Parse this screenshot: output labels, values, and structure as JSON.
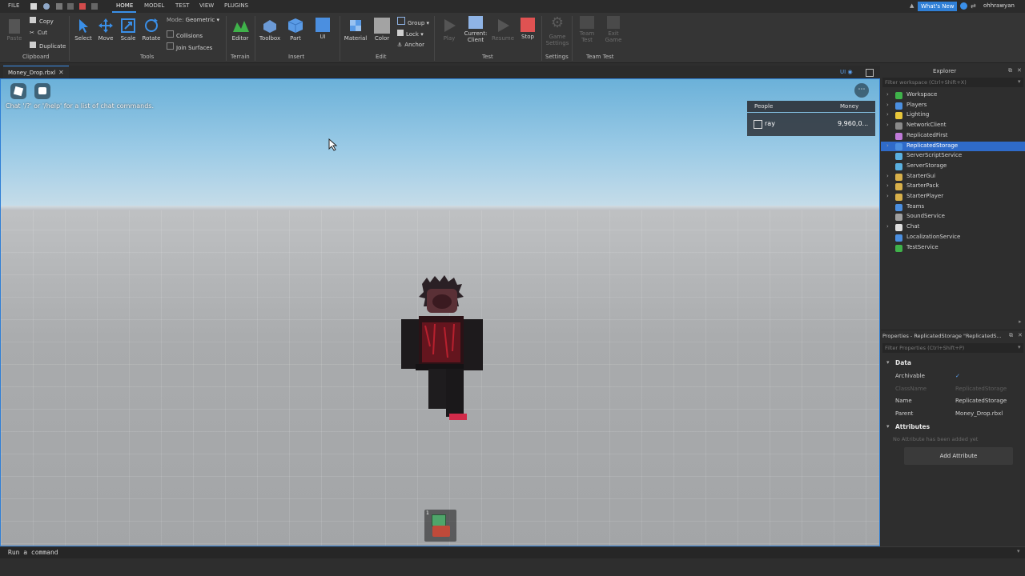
{
  "menubar": {
    "items": [
      "FILE",
      "HOME",
      "MODEL",
      "TEST",
      "VIEW",
      "PLUGINS"
    ],
    "whats_new": "What's New",
    "username": "ohhrawyan"
  },
  "ribbon": {
    "clipboard": {
      "paste": "Paste",
      "copy": "Copy",
      "cut": "Cut",
      "duplicate": "Duplicate",
      "group_label": "Clipboard"
    },
    "tools": {
      "select": "Select",
      "move": "Move",
      "scale": "Scale",
      "rotate": "Rotate",
      "mode_label": "Mode:",
      "mode_value": "Geometric",
      "collisions": "Collisions",
      "join_surfaces": "Join Surfaces",
      "group_label": "Tools"
    },
    "terrain": {
      "editor": "Editor",
      "group_label": "Terrain"
    },
    "insert": {
      "toolbox": "Toolbox",
      "part": "Part",
      "ui": "UI",
      "group_label": "Insert"
    },
    "edit": {
      "material": "Material",
      "color": "Color",
      "group": "Group",
      "lock": "Lock",
      "anchor": "Anchor",
      "group_label": "Edit"
    },
    "test": {
      "play": "Play",
      "current_client_1": "Current:",
      "current_client_2": "Client",
      "resume": "Resume",
      "stop": "Stop",
      "group_label": "Test"
    },
    "settings": {
      "game_settings_1": "Game",
      "game_settings_2": "Settings",
      "group_label": "Settings"
    },
    "team_test": {
      "team_test_1": "Team",
      "team_test_2": "Test",
      "exit_game_1": "Exit",
      "exit_game_2": "Game",
      "group_label": "Team Test"
    }
  },
  "tab": {
    "name": "Money_Drop.rbxl"
  },
  "viewport": {
    "chat_hint": "Chat '/?' or '/help' for a list of chat commands.",
    "leaderboard": {
      "col_people": "People",
      "col_money": "Money",
      "player": "ray",
      "money": "9,960,0..."
    },
    "ui_toggle": "UI"
  },
  "explorer": {
    "title": "Explorer",
    "filter_placeholder": "Filter workspace (Ctrl+Shift+X)",
    "items": [
      {
        "label": "Workspace",
        "expand": true,
        "color": "#3fb24a"
      },
      {
        "label": "Players",
        "expand": true,
        "color": "#4b8fe0"
      },
      {
        "label": "Lighting",
        "expand": true,
        "color": "#e8c63a"
      },
      {
        "label": "NetworkClient",
        "expand": true,
        "color": "#8a8a8a"
      },
      {
        "label": "ReplicatedFirst",
        "expand": false,
        "color": "#c07ad8"
      },
      {
        "label": "ReplicatedStorage",
        "expand": true,
        "color": "#4b8fe0",
        "selected": true
      },
      {
        "label": "ServerScriptService",
        "expand": false,
        "color": "#5ab0e0"
      },
      {
        "label": "ServerStorage",
        "expand": false,
        "color": "#5ab0e0"
      },
      {
        "label": "StarterGui",
        "expand": true,
        "color": "#d8b04a"
      },
      {
        "label": "StarterPack",
        "expand": true,
        "color": "#d8b04a"
      },
      {
        "label": "StarterPlayer",
        "expand": true,
        "color": "#d8b04a"
      },
      {
        "label": "Teams",
        "expand": false,
        "color": "#4b8fe0"
      },
      {
        "label": "SoundService",
        "expand": false,
        "color": "#a0a0a0"
      },
      {
        "label": "Chat",
        "expand": true,
        "color": "#e0e0e0"
      },
      {
        "label": "LocalizationService",
        "expand": false,
        "color": "#4b8fe0"
      },
      {
        "label": "TestService",
        "expand": false,
        "color": "#3fb24a"
      }
    ]
  },
  "properties": {
    "title": "Properties - ReplicatedStorage \"ReplicatedS...",
    "filter_placeholder": "Filter Properties (Ctrl+Shift+P)",
    "section_data": "Data",
    "rows": [
      {
        "name": "Archivable",
        "value": "✓"
      },
      {
        "name": "ClassName",
        "value": "ReplicatedStorage",
        "dim": true
      },
      {
        "name": "Name",
        "value": "ReplicatedStorage"
      },
      {
        "name": "Parent",
        "value": "Money_Drop.rbxl"
      }
    ],
    "section_attributes": "Attributes",
    "no_attributes": "No Attribute has been added yet",
    "add_attribute": "Add Attribute"
  },
  "command_bar": {
    "placeholder": "Run a command"
  }
}
